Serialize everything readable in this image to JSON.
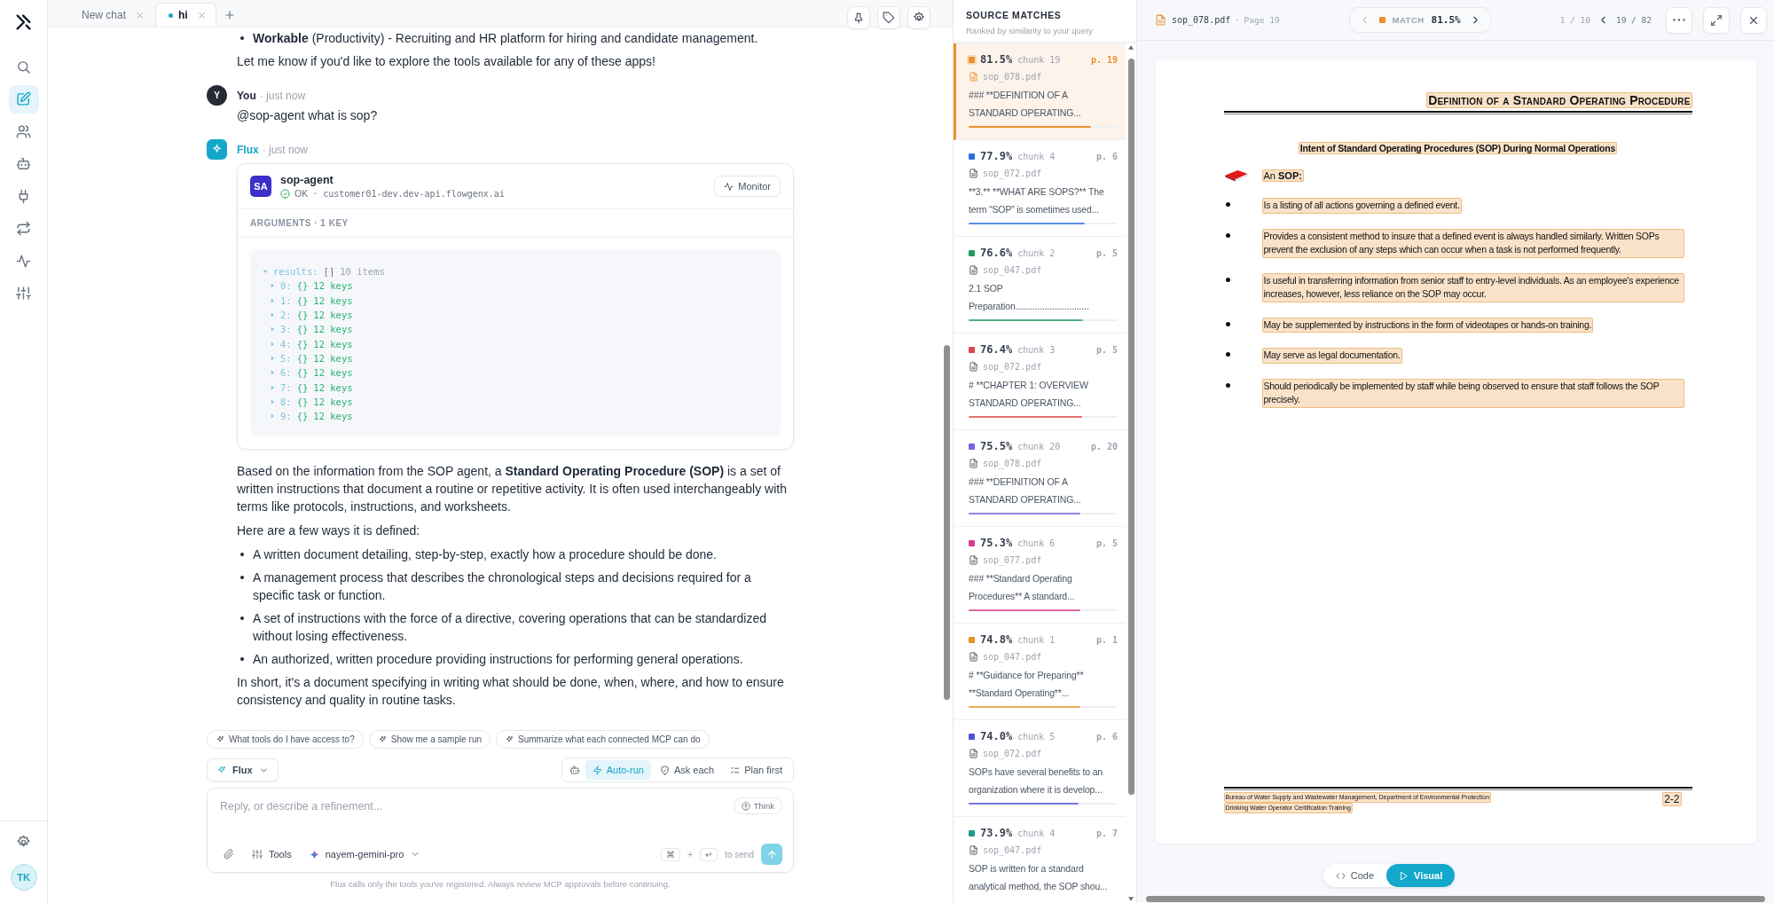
{
  "rail": {
    "items": [
      {
        "kind": "search",
        "selected": false
      },
      {
        "kind": "edit",
        "selected": true
      },
      {
        "kind": "users",
        "selected": false
      },
      {
        "kind": "bot",
        "selected": false
      },
      {
        "kind": "plug",
        "selected": false
      },
      {
        "kind": "repeat",
        "selected": false
      },
      {
        "kind": "activity",
        "selected": false
      },
      {
        "kind": "sliders",
        "selected": false
      }
    ],
    "avatar": "TK"
  },
  "tabs": [
    {
      "label": "New chat",
      "selected": false,
      "unsaved": false
    },
    {
      "label": "hi",
      "selected": true,
      "unsaved": true
    }
  ],
  "chat": {
    "previous": {
      "bullets": [
        "**Workable** (Productivity) - Recruiting and HR platform for hiring and candidate management."
      ],
      "text": "Let me know if you'd like to explore the tools available for any of these apps!"
    },
    "messages": [
      {
        "kind": "user",
        "avatar": "Y",
        "author": "You",
        "time": "· just now",
        "blocks": [
          {
            "kind": "paragraph",
            "text": "@sop-agent what is sop?"
          }
        ]
      },
      {
        "kind": "assistant",
        "author": "Flux",
        "time": "· just now",
        "tool_call": {
          "badge": "SA",
          "name": "sop-agent",
          "status": "OK",
          "host": "· customer01-dev.dev-api.flowgenx.ai",
          "button": "Monitor",
          "arguments_label": "ARGUMENTS · 1 KEY",
          "tree": {
            "key": "results:",
            "type": "[]",
            "summary": "10 items",
            "expanded": true,
            "children": [
              {
                "key": "0:",
                "type": "{}",
                "summary": "12 keys",
                "expanded": false
              },
              {
                "key": "1:",
                "type": "{}",
                "summary": "12 keys",
                "expanded": false
              },
              {
                "key": "2:",
                "type": "{}",
                "summary": "12 keys",
                "expanded": false
              },
              {
                "key": "3:",
                "type": "{}",
                "summary": "12 keys",
                "expanded": false
              },
              {
                "key": "4:",
                "type": "{}",
                "summary": "12 keys",
                "expanded": false
              },
              {
                "key": "5:",
                "type": "{}",
                "summary": "12 keys",
                "expanded": false
              },
              {
                "key": "6:",
                "type": "{}",
                "summary": "12 keys",
                "expanded": false
              },
              {
                "key": "7:",
                "type": "{}",
                "summary": "12 keys",
                "expanded": false
              },
              {
                "key": "8:",
                "type": "{}",
                "summary": "12 keys",
                "expanded": false
              },
              {
                "key": "9:",
                "type": "{}",
                "summary": "12 keys",
                "expanded": false
              }
            ]
          }
        },
        "blocks": [
          {
            "kind": "paragraph",
            "text": "Based on the information from the SOP agent, a **Standard Operating Procedure (SOP)** is a set of written instructions that document a routine or repetitive activity. It is often used interchangeably with terms like protocols, instructions, and worksheets."
          },
          {
            "kind": "paragraph",
            "text": "Here are a few ways it is defined:"
          },
          {
            "kind": "list",
            "items": [
              "A written document detailing, step-by-step, exactly how a procedure should be done.",
              "A management process that describes the chronological steps and decisions required for a specific task or function.",
              "A set of instructions with the force of a directive, covering operations that can be standardized without losing effectiveness.",
              "An authorized, written procedure providing instructions for performing general operations."
            ]
          },
          {
            "kind": "paragraph",
            "text": "In short, it's a document specifying in writing what should be done, when, where, and how to ensure consistency and quality in routine tasks."
          }
        ]
      }
    ]
  },
  "suggestions": [
    "What tools do I have access to?",
    "Show me a sample run",
    "Summarize what each connected MCP can do"
  ],
  "composer": {
    "agent": "Flux",
    "modes": [
      {
        "kind": "auto",
        "label": "Auto-run",
        "selected": true
      },
      {
        "kind": "ask",
        "label": "Ask each",
        "selected": false
      },
      {
        "kind": "plan",
        "label": "Plan first",
        "selected": false
      }
    ],
    "placeholder": "Reply, or describe a refinement...",
    "think": "Think",
    "tools": "Tools",
    "model": "nayem-gemini-pro",
    "shortcut": {
      "keys": [
        "⌘",
        "↵"
      ],
      "joiner": "+",
      "label": "to send"
    },
    "disclaimer": "Flux calls only the tools you've registered. Always review MCP approvals before continuing."
  },
  "sources": {
    "title": "SOURCE MATCHES",
    "subtitle": "Ranked by similarity to your query",
    "items": [
      {
        "score": "81.5%",
        "chunk": "chunk 19",
        "page": "p. 19",
        "file": "sop_078.pdf",
        "snippet": "### **DEFINITION OF A STANDARD OPERATING...",
        "color": "#e8912d",
        "level": 0.82,
        "selected": true
      },
      {
        "score": "77.9%",
        "chunk": "chunk 4",
        "page": "p. 6",
        "file": "sop_072.pdf",
        "snippet": "**3.** **WHAT ARE SOPS?** The term “SOP” is sometimes used...",
        "color": "#2f6fe4",
        "level": 0.78,
        "selected": false
      },
      {
        "score": "76.6%",
        "chunk": "chunk 2",
        "page": "p. 5",
        "file": "sop_047.pdf",
        "snippet": "2.1 SOP Preparation..............................",
        "color": "#1f9d5a",
        "level": 0.77,
        "selected": false
      },
      {
        "score": "76.4%",
        "chunk": "chunk 3",
        "page": "p. 5",
        "file": "sop_072.pdf",
        "snippet": "# **CHAPTER 1: OVERVIEW STANDARD OPERATING...",
        "color": "#e04848",
        "level": 0.76,
        "selected": false
      },
      {
        "score": "75.5%",
        "chunk": "chunk 20",
        "page": "p. 20",
        "file": "sop_078.pdf",
        "snippet": "### **DEFINITION OF A STANDARD OPERATING...",
        "color": "#7b5ce6",
        "level": 0.75,
        "selected": false
      },
      {
        "score": "75.3%",
        "chunk": "chunk 6",
        "page": "p. 5",
        "file": "sop_077.pdf",
        "snippet": "### **Standard Operating Procedures** A standard...",
        "color": "#d63e8b",
        "level": 0.75,
        "selected": false
      },
      {
        "score": "74.8%",
        "chunk": "chunk 1",
        "page": "p. 1",
        "file": "sop_047.pdf",
        "snippet": "# **Guidance for Preparing** **Standard Operating**...",
        "color": "#e8912d",
        "level": 0.75,
        "selected": false
      },
      {
        "score": "74.0%",
        "chunk": "chunk 5",
        "page": "p. 6",
        "file": "sop_072.pdf",
        "snippet": "SOPs have several benefits to an organization where it is develop...",
        "color": "#4f4fd6",
        "level": 0.74,
        "selected": false
      },
      {
        "score": "73.9%",
        "chunk": "chunk 4",
        "page": "p. 7",
        "file": "sop_047.pdf",
        "snippet": "SOP is written for a standard analytical method, the SOP shou...",
        "color": "#1a9c8e",
        "selected": false
      }
    ]
  },
  "viewer": {
    "file": "sop_078.pdf",
    "separator": "·",
    "page": "Page 19",
    "match": {
      "label": "MATCH",
      "score": "81.5%",
      "color": "#e8912d",
      "prev_disabled": true
    },
    "match_index": "1 / 10",
    "page_index": "19 / 82",
    "document": {
      "highlighted": true,
      "title": "Definition of a Standard Operating Procedure",
      "subtitle": "Intent of Standard Operating Procedures (SOP) During Normal Operations",
      "lead": "An **SOP:**",
      "bullets": [
        "Is a listing of all actions governing a defined event.",
        "Provides a consistent method to insure that a defined event is always handled similarly. Written SOPs prevent the exclusion of any steps which can occur when a task is not performed frequently.",
        "Is useful in transferring information from senior staff to entry-level individuals. As an employee's experience increases, however, less reliance on the SOP may occur.",
        "May be supplemented by instructions in the form of videotapes or hands-on training.",
        "May serve as legal documentation.",
        "Should periodically be implemented by staff while being observed to ensure that staff follows the SOP precisely."
      ],
      "footer": [
        "Bureau of Water Supply and Wastewater Management, Department of Environmental Protection",
        "Drinking Water Operator Certification Training"
      ],
      "page_number": "2-2"
    },
    "views": [
      {
        "kind": "code",
        "label": "Code",
        "selected": false
      },
      {
        "kind": "visual",
        "label": "Visual",
        "selected": true
      }
    ]
  }
}
